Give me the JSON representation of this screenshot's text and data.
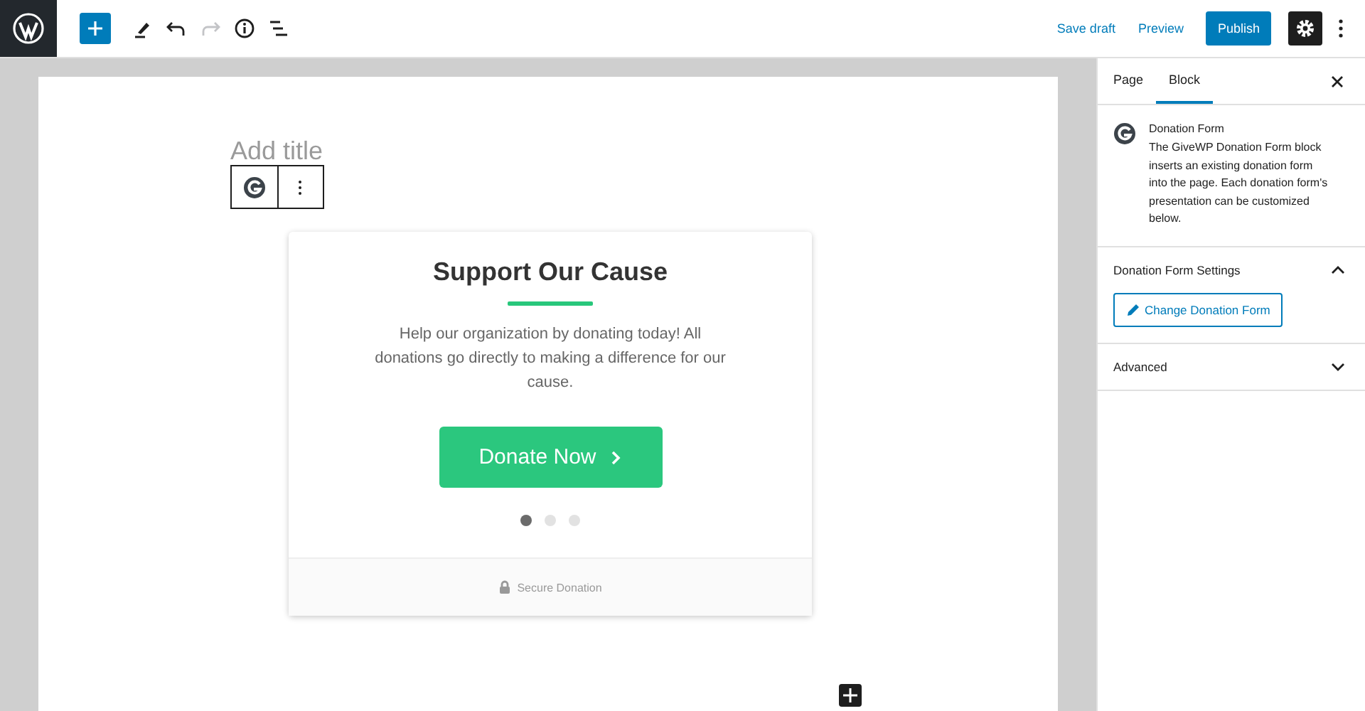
{
  "toolbar": {
    "tools": [
      {
        "kind": "add",
        "disabled": false
      },
      {
        "kind": "edit",
        "disabled": false
      },
      {
        "kind": "undo",
        "disabled": false
      },
      {
        "kind": "redo",
        "disabled": true
      },
      {
        "kind": "info",
        "disabled": false
      },
      {
        "kind": "outline",
        "disabled": false
      }
    ],
    "save_draft": "Save draft",
    "preview": "Preview",
    "publish": "Publish",
    "settings_on": true
  },
  "editor": {
    "title": {
      "placeholder": "Add title"
    },
    "form": {
      "heading": "Support Our Cause",
      "description": "Help our organization by donating today! All donations go directly to making a difference for our cause.",
      "donate_button": "Donate Now",
      "dots": [
        {
          "selected": true
        },
        {
          "selected": false
        },
        {
          "selected": false
        }
      ],
      "footer": "Secure Donation"
    }
  },
  "sidebar": {
    "tabs": [
      {
        "label": "Page",
        "selected": false
      },
      {
        "label": "Block",
        "selected": true
      }
    ],
    "block": {
      "name": "Donation Form",
      "description": "The GiveWP Donation Form block inserts an existing donation form into the page. Each donation form's presentation can be customized below."
    },
    "panels": [
      {
        "title": "Donation Form Settings",
        "expanded": true,
        "button": "Change Donation Form"
      },
      {
        "title": "Advanced",
        "expanded": false
      }
    ]
  }
}
